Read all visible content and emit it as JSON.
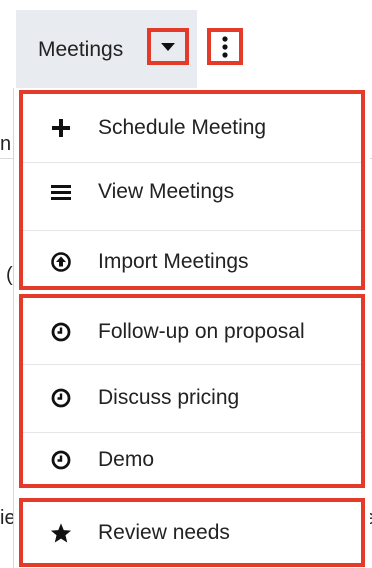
{
  "module_tab": {
    "label": "Meetings",
    "caret_icon": "caret-down-icon",
    "kebab_icon": "kebab-icon"
  },
  "menu": {
    "actions": [
      {
        "label": "Schedule Meeting",
        "icon": "plus-icon"
      },
      {
        "label": "View Meetings",
        "icon": "list-icon"
      },
      {
        "label": "Import Meetings",
        "icon": "upload-circle-icon"
      }
    ],
    "recents": [
      {
        "label": "Follow-up on proposal",
        "icon": "clock-icon"
      },
      {
        "label": "Discuss pricing",
        "icon": "clock-icon"
      },
      {
        "label": "Demo",
        "icon": "clock-icon"
      }
    ],
    "favorites": [
      {
        "label": "Review needs",
        "icon": "star-icon"
      }
    ]
  },
  "background_fragments": {
    "left_top": "n",
    "left_mid": "(",
    "left_bottom": "ie",
    "right_bottom": "e"
  },
  "colors": {
    "highlight": "#e43a2a",
    "tab_bg": "#e8ebef"
  }
}
